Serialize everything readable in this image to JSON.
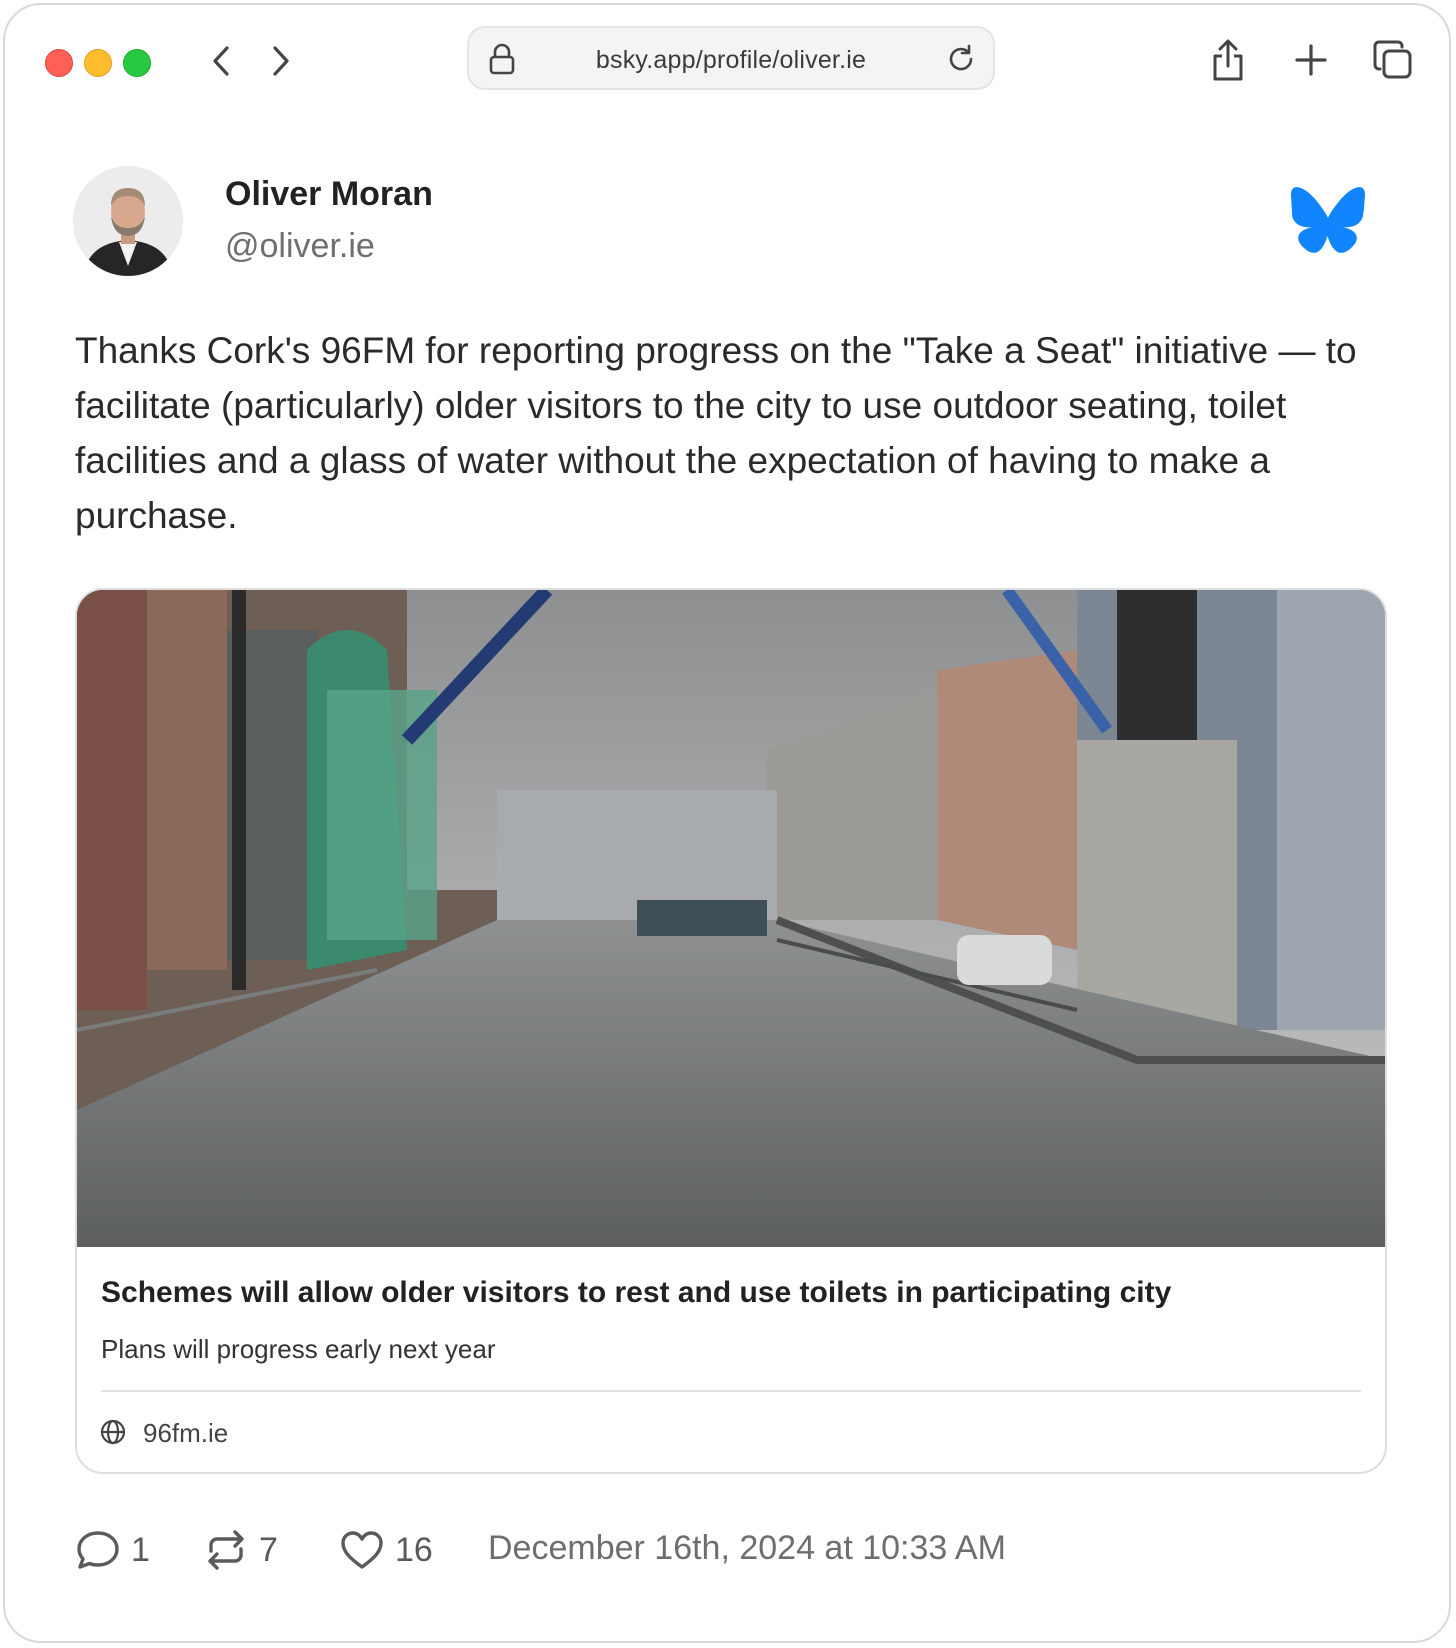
{
  "browser": {
    "url": "bsky.app/profile/oliver.ie"
  },
  "profile": {
    "display_name": "Oliver Moran",
    "handle": "@oliver.ie"
  },
  "post": {
    "text": "Thanks Cork's 96FM for reporting progress on the \"Take a Seat\" initiative — to facilitate (particularly) older visitors to the city to use outdoor seating, toilet facilities and a glass of water without the expectation of having to make a purchase."
  },
  "embed": {
    "title": "Schemes will allow older visitors to rest and use toilets in participating city",
    "description": "Plans will progress early next year",
    "domain": "96fm.ie"
  },
  "stats": {
    "replies": "1",
    "reposts": "7",
    "likes": "16",
    "timestamp": "December 16th, 2024 at 10:33 AM"
  },
  "colors": {
    "bluesky_blue": "#1185fe",
    "traffic_red": "#fe5f57",
    "traffic_yellow": "#febc2e",
    "traffic_green": "#28c840"
  },
  "icons": [
    "lock-icon",
    "reload-icon",
    "share-icon",
    "plus-icon",
    "tabs-icon",
    "chevron-left-icon",
    "chevron-right-icon",
    "bluesky-butterfly-icon",
    "globe-icon",
    "reply-icon",
    "repost-icon",
    "heart-icon"
  ]
}
